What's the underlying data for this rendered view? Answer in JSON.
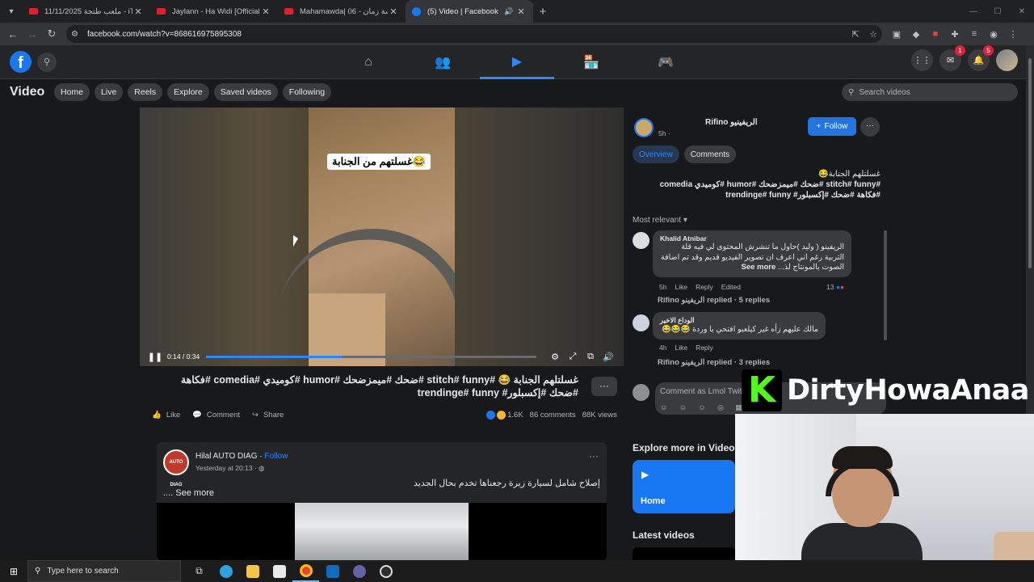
{
  "browser": {
    "tabs": [
      {
        "title": "ملعب طنجة 11/11/2025 - iTube",
        "active": false
      },
      {
        "title": "Jaylann - Ha Widi [Official Mus",
        "active": false
      },
      {
        "title": "Mahamawda| 06 - مدرسة زمان",
        "active": false
      },
      {
        "title": "(5) Video | Facebook",
        "active": true
      }
    ],
    "url": "facebook.com/watch?v=868616975895308"
  },
  "fbnav": {
    "logo": "f",
    "messenger_badge": "1",
    "notifications_badge": "5"
  },
  "video_header": {
    "title": "Video",
    "pills": [
      "Home",
      "Live",
      "Reels",
      "Explore",
      "Saved videos",
      "Following"
    ],
    "search_placeholder": "Search videos"
  },
  "player": {
    "caption": "غسلتهم من الجنابة😂",
    "time": "0:14 / 0:34",
    "progress": 0.41
  },
  "post": {
    "title": "غسلتلهم الجنابة 😂 #stitch# funny #ضحك #ميمزضحك #humor #كوميدي #comedia #فكاهة #ضحك #إكسبلور# trendinge# funny",
    "like_label": "Like",
    "comment_label": "Comment",
    "share_label": "Share",
    "reactions_count": "1.6K",
    "comments_count": "86 comments",
    "views_count": "88K views"
  },
  "feed_post": {
    "author": "Hilal AUTO DIAG",
    "follow": "Follow",
    "time": "Yesterday at 20:13",
    "text": "إصلاح شامل لسيارة زيرة رجعناها تخدم بحال الجديد",
    "see_more": ".... See more",
    "avatar_text": "AUTO DIAG"
  },
  "channel": {
    "name": "Rifino الريفينيو",
    "time": "5h ·",
    "follow_label": "Follow",
    "tab_overview": "Overview",
    "tab_comments": "Comments",
    "desc_line1": "غسلتلهم الجنابة😂",
    "desc_line2": "#stitch# funny #ضحك #ميمزضحك #humor #كوميدي comedia",
    "desc_line3": "#فكاهة #ضحك #إكسبلور# trendinge# funny",
    "sort_label": "Most relevant"
  },
  "comments": [
    {
      "author": "Khalid Atnibar",
      "text": "الريفينو ( وليد )حاول ما تنشرش المحتوى لي فيه قلة التربية رغم اني اعرف ان تصوير الفيديو قديم وقد تم اضافة الصوت بالمونتاج لذ...",
      "see_more": "See more",
      "time": "5h",
      "like": "Like",
      "reply": "Reply",
      "edited": "Edited",
      "count": "13",
      "replies": "Rifino الريفينو replied · 5 replies"
    },
    {
      "author": "الوداع الاخير",
      "text": "مالك عليهم زأه غير كيلعبو افتحي يا وردة 😂😂😂",
      "time": "4h",
      "like": "Like",
      "reply": "Reply",
      "replies": "Rifino الريفينو replied · 3 replies"
    }
  ],
  "comment_box": {
    "placeholder": "Comment as Lmol Twit"
  },
  "explore": {
    "title": "Explore more in Video",
    "home_label": "Home",
    "latest_title": "Latest videos"
  },
  "overlay": {
    "brand_letter": "K",
    "brand_name": "DirtyHowaAnaa"
  },
  "taskbar": {
    "search_placeholder": "Type here to search"
  },
  "colors": {
    "fb_blue": "#1877f2",
    "accent": "#2d88ff",
    "kick_green": "#53fc18"
  }
}
